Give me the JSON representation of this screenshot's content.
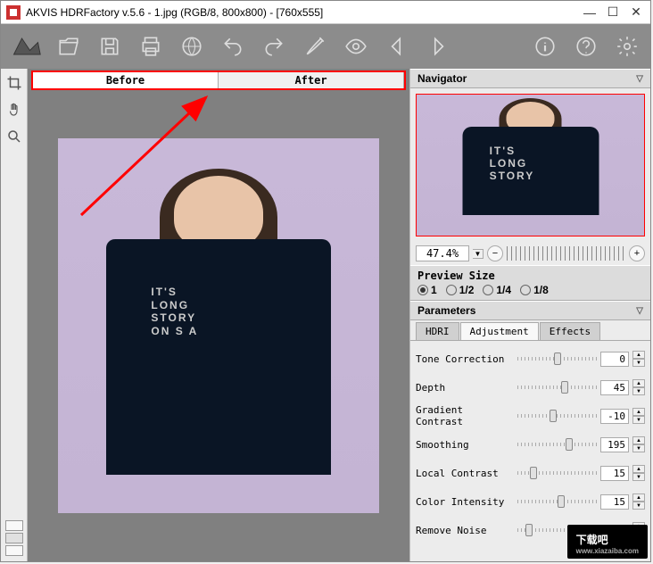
{
  "title": "AKVIS HDRFactory v.5.6 - 1.jpg (RGB/8, 800x800) - [760x555]",
  "tabs": {
    "before": "Before",
    "after": "After"
  },
  "navigator": {
    "title": "Navigator"
  },
  "zoom": {
    "value": "47.4%"
  },
  "previewSize": {
    "title": "Preview Size",
    "options": [
      {
        "label": "1",
        "checked": true
      },
      {
        "label": "1/2",
        "checked": false
      },
      {
        "label": "1/4",
        "checked": false
      },
      {
        "label": "1/8",
        "checked": false
      }
    ]
  },
  "parameters": {
    "title": "Parameters",
    "tabs": {
      "hdri": "HDRI",
      "adjustment": "Adjustment",
      "effects": "Effects",
      "active": "adjustment"
    },
    "rows": [
      {
        "label": "Tone Correction",
        "value": "0",
        "pos": 50
      },
      {
        "label": "Depth",
        "value": "45",
        "pos": 60
      },
      {
        "label": "Gradient Contrast",
        "value": "-10",
        "pos": 45
      },
      {
        "label": "Smoothing",
        "value": "195",
        "pos": 65
      },
      {
        "label": "Local Contrast",
        "value": "15",
        "pos": 20
      },
      {
        "label": "Color Intensity",
        "value": "15",
        "pos": 55
      },
      {
        "label": "Remove Noise",
        "value": "",
        "pos": 15
      }
    ]
  },
  "shirt": {
    "l1": "IT'S",
    "l2": "LONG",
    "l3": "STORY",
    "l4": "ON S A"
  },
  "watermark": {
    "main": "下载吧",
    "sub": "www.xiazaiba.com"
  }
}
